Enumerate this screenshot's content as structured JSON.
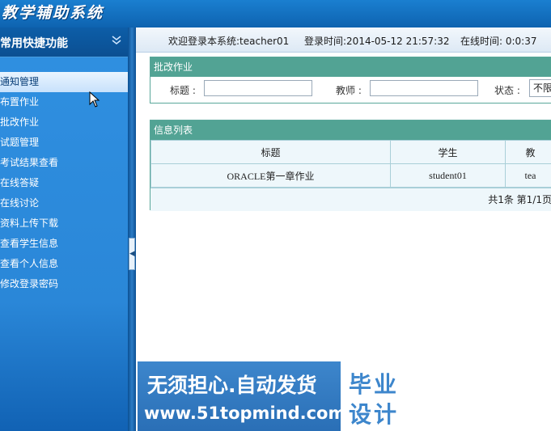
{
  "app": {
    "title": "教学辅助系统"
  },
  "sidebar": {
    "header": "常用快捷功能",
    "collapse_icon": "chevron-double-down-icon",
    "items": [
      {
        "label": "通知管理",
        "active": true
      },
      {
        "label": "布置作业"
      },
      {
        "label": "批改作业"
      },
      {
        "label": "试题管理"
      },
      {
        "label": "考试结果查看"
      },
      {
        "label": "在线答疑"
      },
      {
        "label": "在线讨论"
      },
      {
        "label": "资料上传下载"
      },
      {
        "label": "查看学生信息"
      },
      {
        "label": "查看个人信息"
      },
      {
        "label": "修改登录密码"
      }
    ]
  },
  "status_bar": {
    "welcome": "欢迎登录本系统:teacher01",
    "login_time": "登录时间:2014-05-12 21:57:32",
    "online_time": "在线时间: 0:0:37"
  },
  "search_panel": {
    "title": "批改作业",
    "fields": {
      "title_label": "标题 :",
      "teacher_label": "教师 :",
      "status_label": "状态 :",
      "status_value": "不限"
    }
  },
  "list_panel": {
    "title": "信息列表",
    "columns": [
      "标题",
      "学生",
      "教"
    ],
    "rows": [
      [
        "ORACLE第一章作业",
        "student01",
        "tea"
      ]
    ],
    "pager": "共1条  第1/1页"
  },
  "watermark": {
    "line1": "无须担心.自动发货",
    "line2": "www.51topmind.com",
    "right_line1": "毕业",
    "right_line2": "设计"
  },
  "colors": {
    "header_blue": "#0e63b0",
    "sidebar_blue": "#2a87d8",
    "panel_teal": "#52a394",
    "table_bg": "#eef7fb"
  }
}
